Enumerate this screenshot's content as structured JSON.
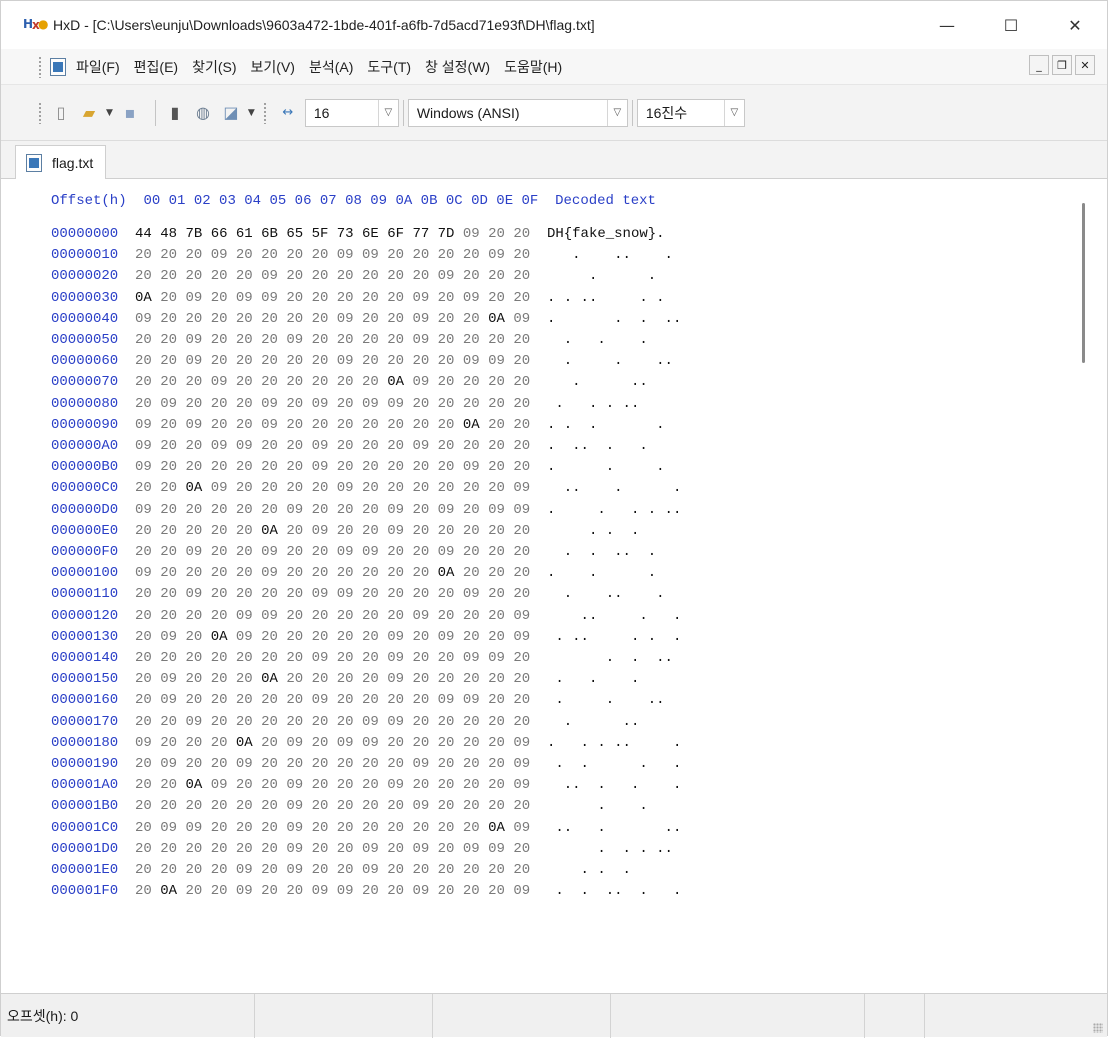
{
  "window": {
    "title": "HxD - [C:\\Users\\eunju\\Downloads\\9603a472-1bde-401f-a6fb-7d5acd71e93f\\DH\\flag.txt]",
    "app_icon_text": "HxD"
  },
  "menu": {
    "items": [
      "파일(F)",
      "편집(E)",
      "찾기(S)",
      "보기(V)",
      "분석(A)",
      "도구(T)",
      "창 설정(W)",
      "도움말(H)"
    ]
  },
  "toolbar": {
    "bytes_per_row": "16",
    "encoding": "Windows (ANSI)",
    "base": "16진수"
  },
  "tab": {
    "label": "flag.txt"
  },
  "hex": {
    "header": {
      "offset_label": "Offset(h)",
      "columns": "00 01 02 03 04 05 06 07 08 09 0A 0B 0C 0D 0E 0F",
      "decoded_label": "Decoded text"
    },
    "rows": [
      {
        "offset": "00000000",
        "bytes": [
          "44",
          "48",
          "7B",
          "66",
          "61",
          "6B",
          "65",
          "5F",
          "73",
          "6E",
          "6F",
          "77",
          "7D",
          "09",
          "20",
          "20"
        ],
        "decoded": "DH{fake_snow}.  "
      },
      {
        "offset": "00000010",
        "bytes": [
          "20",
          "20",
          "20",
          "09",
          "20",
          "20",
          "20",
          "20",
          "09",
          "09",
          "20",
          "20",
          "20",
          "20",
          "09",
          "20"
        ],
        "decoded": "   .    ..    . "
      },
      {
        "offset": "00000020",
        "bytes": [
          "20",
          "20",
          "20",
          "20",
          "20",
          "09",
          "20",
          "20",
          "20",
          "20",
          "20",
          "20",
          "09",
          "20",
          "20",
          "20"
        ],
        "decoded": "     .      .   "
      },
      {
        "offset": "00000030",
        "bytes": [
          "0A",
          "20",
          "09",
          "20",
          "09",
          "09",
          "20",
          "20",
          "20",
          "20",
          "20",
          "09",
          "20",
          "09",
          "20",
          "20"
        ],
        "decoded": ". . ..     . .  "
      },
      {
        "offset": "00000040",
        "bytes": [
          "09",
          "20",
          "20",
          "20",
          "20",
          "20",
          "20",
          "20",
          "09",
          "20",
          "20",
          "09",
          "20",
          "20",
          "0A",
          "09"
        ],
        "decoded": ".       .  .  .."
      },
      {
        "offset": "00000050",
        "bytes": [
          "20",
          "20",
          "09",
          "20",
          "20",
          "20",
          "09",
          "20",
          "20",
          "20",
          "20",
          "09",
          "20",
          "20",
          "20",
          "20"
        ],
        "decoded": "  .   .    .    "
      },
      {
        "offset": "00000060",
        "bytes": [
          "20",
          "20",
          "09",
          "20",
          "20",
          "20",
          "20",
          "20",
          "09",
          "20",
          "20",
          "20",
          "20",
          "09",
          "09",
          "20"
        ],
        "decoded": "  .     .    .. "
      },
      {
        "offset": "00000070",
        "bytes": [
          "20",
          "20",
          "20",
          "09",
          "20",
          "20",
          "20",
          "20",
          "20",
          "20",
          "0A",
          "09",
          "20",
          "20",
          "20",
          "20"
        ],
        "decoded": "   .      ..    "
      },
      {
        "offset": "00000080",
        "bytes": [
          "20",
          "09",
          "20",
          "20",
          "20",
          "09",
          "20",
          "09",
          "20",
          "09",
          "09",
          "20",
          "20",
          "20",
          "20",
          "20"
        ],
        "decoded": " .   . . ..     "
      },
      {
        "offset": "00000090",
        "bytes": [
          "09",
          "20",
          "09",
          "20",
          "20",
          "09",
          "20",
          "20",
          "20",
          "20",
          "20",
          "20",
          "20",
          "0A",
          "20",
          "20"
        ],
        "decoded": ". .  .       .  "
      },
      {
        "offset": "000000A0",
        "bytes": [
          "09",
          "20",
          "20",
          "09",
          "09",
          "20",
          "20",
          "09",
          "20",
          "20",
          "20",
          "09",
          "20",
          "20",
          "20",
          "20"
        ],
        "decoded": ".  ..  .   .    "
      },
      {
        "offset": "000000B0",
        "bytes": [
          "09",
          "20",
          "20",
          "20",
          "20",
          "20",
          "20",
          "09",
          "20",
          "20",
          "20",
          "20",
          "20",
          "09",
          "20",
          "20"
        ],
        "decoded": ".      .     .  "
      },
      {
        "offset": "000000C0",
        "bytes": [
          "20",
          "20",
          "0A",
          "09",
          "20",
          "20",
          "20",
          "20",
          "09",
          "20",
          "20",
          "20",
          "20",
          "20",
          "20",
          "09"
        ],
        "decoded": "  ..    .      ."
      },
      {
        "offset": "000000D0",
        "bytes": [
          "09",
          "20",
          "20",
          "20",
          "20",
          "20",
          "09",
          "20",
          "20",
          "20",
          "09",
          "20",
          "09",
          "20",
          "09",
          "09"
        ],
        "decoded": ".     .   . . .."
      },
      {
        "offset": "000000E0",
        "bytes": [
          "20",
          "20",
          "20",
          "20",
          "20",
          "0A",
          "20",
          "09",
          "20",
          "20",
          "09",
          "20",
          "20",
          "20",
          "20",
          "20"
        ],
        "decoded": "     . .  .     "
      },
      {
        "offset": "000000F0",
        "bytes": [
          "20",
          "20",
          "09",
          "20",
          "20",
          "09",
          "20",
          "20",
          "09",
          "09",
          "20",
          "20",
          "09",
          "20",
          "20",
          "20"
        ],
        "decoded": "  .  .  ..  .   "
      },
      {
        "offset": "00000100",
        "bytes": [
          "09",
          "20",
          "20",
          "20",
          "20",
          "09",
          "20",
          "20",
          "20",
          "20",
          "20",
          "20",
          "0A",
          "20",
          "20",
          "20"
        ],
        "decoded": ".    .      .   "
      },
      {
        "offset": "00000110",
        "bytes": [
          "20",
          "20",
          "09",
          "20",
          "20",
          "20",
          "20",
          "09",
          "09",
          "20",
          "20",
          "20",
          "20",
          "09",
          "20",
          "20"
        ],
        "decoded": "  .    ..    .  "
      },
      {
        "offset": "00000120",
        "bytes": [
          "20",
          "20",
          "20",
          "20",
          "09",
          "09",
          "20",
          "20",
          "20",
          "20",
          "20",
          "09",
          "20",
          "20",
          "20",
          "09"
        ],
        "decoded": "    ..     .   ."
      },
      {
        "offset": "00000130",
        "bytes": [
          "20",
          "09",
          "20",
          "0A",
          "09",
          "20",
          "20",
          "20",
          "20",
          "20",
          "09",
          "20",
          "09",
          "20",
          "20",
          "09"
        ],
        "decoded": " . ..     . .  ."
      },
      {
        "offset": "00000140",
        "bytes": [
          "20",
          "20",
          "20",
          "20",
          "20",
          "20",
          "20",
          "09",
          "20",
          "20",
          "09",
          "20",
          "20",
          "09",
          "09",
          "20"
        ],
        "decoded": "       .  .  .. "
      },
      {
        "offset": "00000150",
        "bytes": [
          "20",
          "09",
          "20",
          "20",
          "20",
          "0A",
          "20",
          "20",
          "20",
          "20",
          "09",
          "20",
          "20",
          "20",
          "20",
          "20"
        ],
        "decoded": " .   .    .     "
      },
      {
        "offset": "00000160",
        "bytes": [
          "20",
          "09",
          "20",
          "20",
          "20",
          "20",
          "20",
          "09",
          "20",
          "20",
          "20",
          "20",
          "09",
          "09",
          "20",
          "20"
        ],
        "decoded": " .     .    ..  "
      },
      {
        "offset": "00000170",
        "bytes": [
          "20",
          "20",
          "09",
          "20",
          "20",
          "20",
          "20",
          "20",
          "20",
          "09",
          "09",
          "20",
          "20",
          "20",
          "20",
          "20"
        ],
        "decoded": "  .      ..     "
      },
      {
        "offset": "00000180",
        "bytes": [
          "09",
          "20",
          "20",
          "20",
          "0A",
          "20",
          "09",
          "20",
          "09",
          "09",
          "20",
          "20",
          "20",
          "20",
          "20",
          "09"
        ],
        "decoded": ".   . . ..     ."
      },
      {
        "offset": "00000190",
        "bytes": [
          "20",
          "09",
          "20",
          "20",
          "09",
          "20",
          "20",
          "20",
          "20",
          "20",
          "20",
          "09",
          "20",
          "20",
          "20",
          "09"
        ],
        "decoded": " .  .      .   ."
      },
      {
        "offset": "000001A0",
        "bytes": [
          "20",
          "20",
          "0A",
          "09",
          "20",
          "20",
          "09",
          "20",
          "20",
          "20",
          "09",
          "20",
          "20",
          "20",
          "20",
          "09"
        ],
        "decoded": "  ..  .   .    ."
      },
      {
        "offset": "000001B0",
        "bytes": [
          "20",
          "20",
          "20",
          "20",
          "20",
          "20",
          "09",
          "20",
          "20",
          "20",
          "20",
          "09",
          "20",
          "20",
          "20",
          "20"
        ],
        "decoded": "      .    .    "
      },
      {
        "offset": "000001C0",
        "bytes": [
          "20",
          "09",
          "09",
          "20",
          "20",
          "20",
          "09",
          "20",
          "20",
          "20",
          "20",
          "20",
          "20",
          "20",
          "0A",
          "09"
        ],
        "decoded": " ..   .       .."
      },
      {
        "offset": "000001D0",
        "bytes": [
          "20",
          "20",
          "20",
          "20",
          "20",
          "20",
          "09",
          "20",
          "20",
          "09",
          "20",
          "09",
          "20",
          "09",
          "09",
          "20"
        ],
        "decoded": "      .  . . .. "
      },
      {
        "offset": "000001E0",
        "bytes": [
          "20",
          "20",
          "20",
          "20",
          "09",
          "20",
          "09",
          "20",
          "20",
          "09",
          "20",
          "20",
          "20",
          "20",
          "20",
          "20"
        ],
        "decoded": "    . .  .      "
      },
      {
        "offset": "000001F0",
        "bytes": [
          "20",
          "0A",
          "20",
          "20",
          "09",
          "20",
          "20",
          "09",
          "09",
          "20",
          "20",
          "09",
          "20",
          "20",
          "20",
          "09"
        ],
        "decoded": " .  .  ..  .   ."
      }
    ]
  },
  "status": {
    "offset_text": "오프셋(h): 0"
  }
}
